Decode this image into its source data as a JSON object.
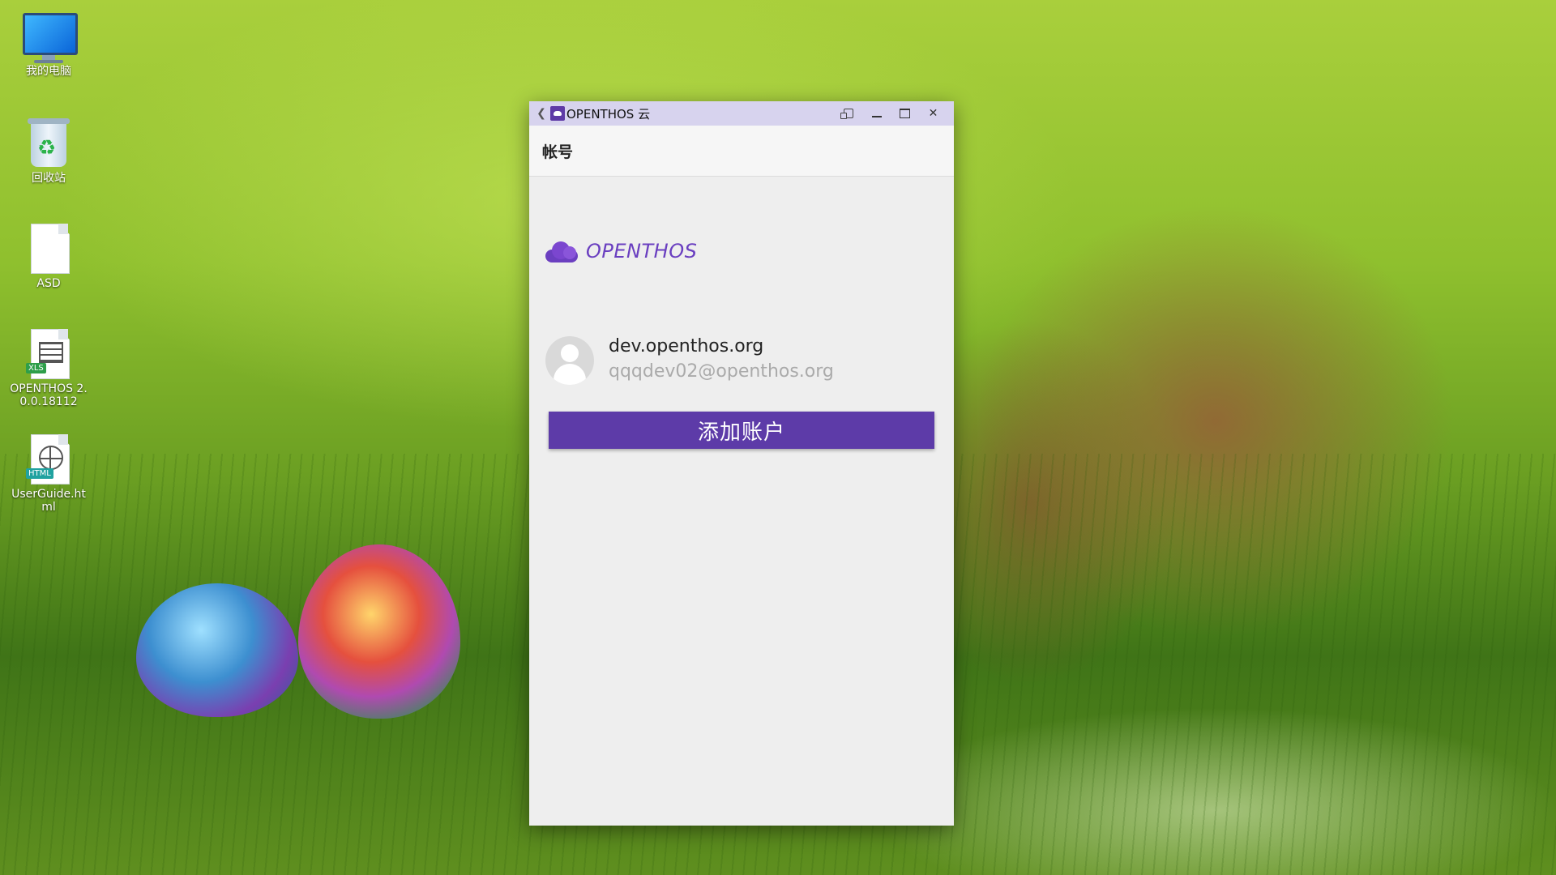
{
  "desktop": {
    "icons": [
      {
        "label": "我的电脑"
      },
      {
        "label": "回收站"
      },
      {
        "label": "ASD"
      },
      {
        "label": "OPENTHOS 2.0.0.18112",
        "badge": "XLS"
      },
      {
        "label": "UserGuide.html",
        "badge": "HTML"
      }
    ]
  },
  "window": {
    "title": "OPENTHOS 云",
    "back_icon": "chevron-left-icon",
    "controls": [
      "rotate-icon",
      "minimize-icon",
      "maximize-icon",
      "close-icon"
    ],
    "header_title": "帐号",
    "brand_name": "OPENTHOS",
    "account": {
      "host": "dev.openthos.org",
      "email": "qqqdev02@openthos.org"
    },
    "add_account_label": "添加账户"
  },
  "colors": {
    "accent": "#5d3ba8",
    "brand": "#6a3fc0",
    "titlebar": "#d7d3ee"
  }
}
